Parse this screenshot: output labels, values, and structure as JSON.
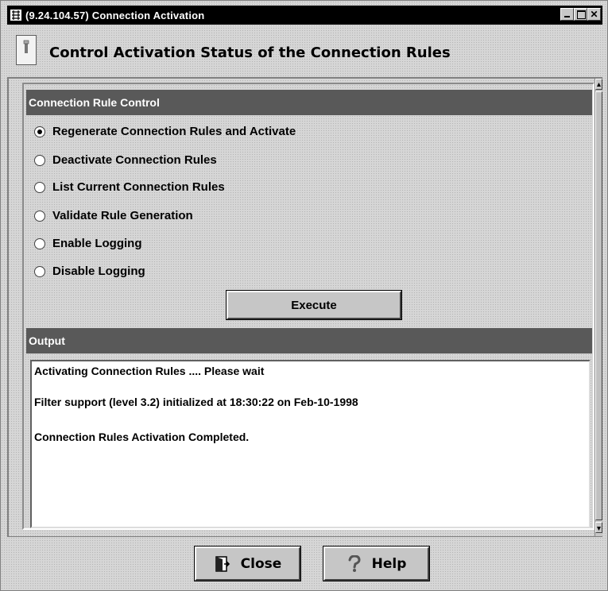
{
  "window": {
    "title": "(9.24.104.57) Connection Activation",
    "controls": [
      "minimize",
      "maximize",
      "close"
    ]
  },
  "header": {
    "title": "Control Activation Status of the Connection Rules",
    "icon": "switch-icon"
  },
  "rule_control": {
    "section_title": "Connection Rule Control",
    "options": [
      {
        "label": "Regenerate Connection Rules and Activate",
        "selected": true
      },
      {
        "label": "Deactivate Connection Rules",
        "selected": false
      },
      {
        "label": "List Current Connection Rules",
        "selected": false
      },
      {
        "label": "Validate Rule Generation",
        "selected": false
      },
      {
        "label": "Enable Logging",
        "selected": false
      },
      {
        "label": "Disable Logging",
        "selected": false
      }
    ],
    "execute_label": "Execute"
  },
  "output": {
    "section_title": "Output",
    "lines": [
      "Activating Connection Rules .... Please wait",
      "Filter support (level 3.2) initialized at 18:30:22 on Feb-10-1998",
      "Connection Rules Activation Completed."
    ]
  },
  "footer": {
    "close_label": "Close",
    "close_icon": "door-exit-icon",
    "help_label": "Help",
    "help_icon": "question-mark-icon"
  }
}
